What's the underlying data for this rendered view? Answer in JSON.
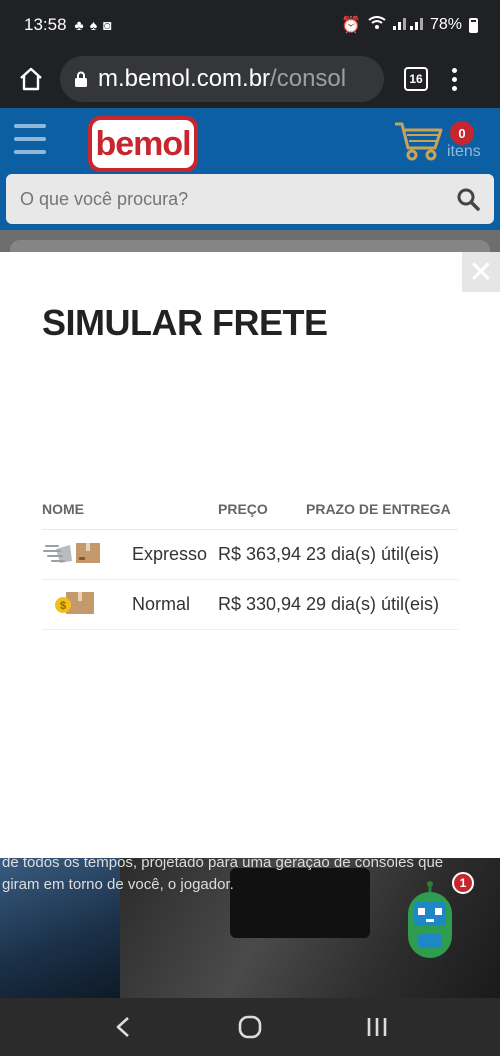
{
  "status_bar": {
    "time": "13:58",
    "battery": "78%"
  },
  "browser": {
    "url_host": "m.bemol.com.br",
    "url_path": "/consol",
    "tab_count": "16"
  },
  "header": {
    "logo_text": "bemol",
    "cart_count": "0",
    "cart_label": "itens",
    "search_placeholder": "O que você procura?"
  },
  "modal": {
    "close_label": "✕",
    "title": "SIMULAR FRETE",
    "columns": {
      "name": "NOME",
      "price": "PREÇO",
      "delivery": "PRAZO DE ENTREGA"
    },
    "rows": [
      {
        "icon": "express-delivery-box-icon",
        "name": "Expresso",
        "price": "R$ 363,94",
        "delivery": "23 dia(s) útil(eis)"
      },
      {
        "icon": "normal-delivery-box-icon",
        "name": "Normal",
        "price": "R$ 330,94",
        "delivery": "29 dia(s) útil(eis)"
      }
    ]
  },
  "background": {
    "text_line1": "de todos os tempos, projetado para uma geração de consoles que",
    "text_line2": "giram em torno de você, o jogador.",
    "chat_badge": "1"
  },
  "colors": {
    "brand_blue": "#0d5fa3",
    "brand_red": "#c8262f"
  }
}
